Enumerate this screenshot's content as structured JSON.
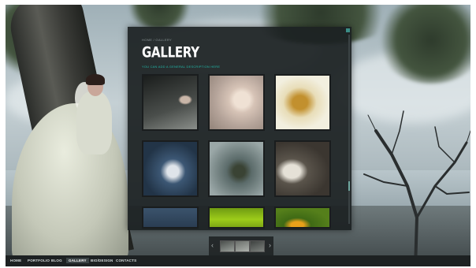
{
  "panel": {
    "breadcrumb": "HOME / GALLERY",
    "title": "GALLERY",
    "subtitle": "YOU CAN ADD A GENERAL DESCRIPTION HERE"
  },
  "gallery": {
    "thumbnails": [
      {
        "subject": "woman-by-rock"
      },
      {
        "subject": "face-with-smoke"
      },
      {
        "subject": "flying-hair"
      },
      {
        "subject": "person-in-blue"
      },
      {
        "subject": "figure-kneeling"
      },
      {
        "subject": "bride-at-tree"
      },
      {
        "subject": "blue-texture"
      },
      {
        "subject": "green-field"
      },
      {
        "subject": "orange-bird"
      }
    ]
  },
  "strip": {
    "prev": "‹",
    "next": "›"
  },
  "menu": {
    "items": [
      "HOME",
      "PORTFOLIO",
      "BLOG",
      "GALLERY",
      "BIO/DESIGN",
      "CONTACTS"
    ],
    "active": "GALLERY"
  },
  "colors": {
    "accent": "#22b6a6",
    "panel": "#1c2122"
  }
}
